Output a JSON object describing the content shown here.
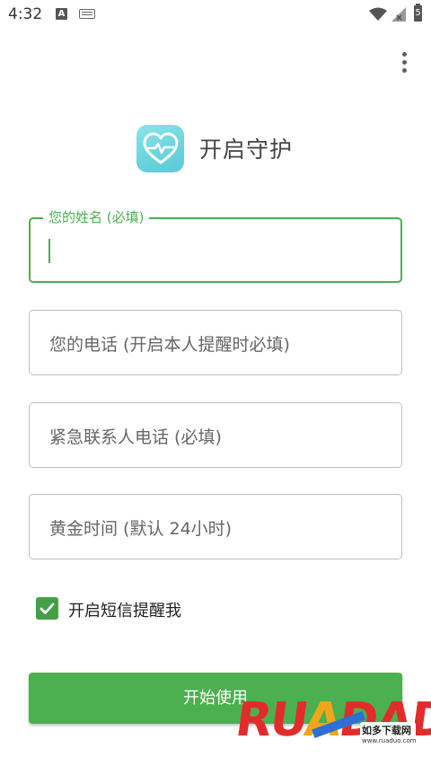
{
  "status_bar": {
    "time": "4:32",
    "notification_a": "A",
    "battery_level": "5"
  },
  "header": {
    "title": "开启守护",
    "app_icon": "heart-pulse-icon"
  },
  "form": {
    "name_label": "您的姓名 (必填)",
    "name_value": "",
    "phone_placeholder": "您的电话 (开启本人提醒时必填)",
    "emergency_placeholder": "紧急联系人电话 (必填)",
    "golden_time_placeholder": "黄金时间 (默认 24小时)",
    "sms_checkbox_label": "开启短信提醒我",
    "sms_checkbox_checked": true
  },
  "start_button": {
    "label": "开始使用"
  },
  "watermark": {
    "brand": "RUANDADO",
    "brand_r": "RU",
    "brand_o": "A",
    "brand_rest": "DADO",
    "cn": "如多下载网",
    "url": "www.ruaduo.com"
  },
  "colors": {
    "accent": "#4caf50",
    "icon_gradient_start": "#8ae5ea",
    "icon_gradient_end": "#59c9d8",
    "watermark_red": "#e32b2b",
    "watermark_orange": "#f1a619"
  }
}
